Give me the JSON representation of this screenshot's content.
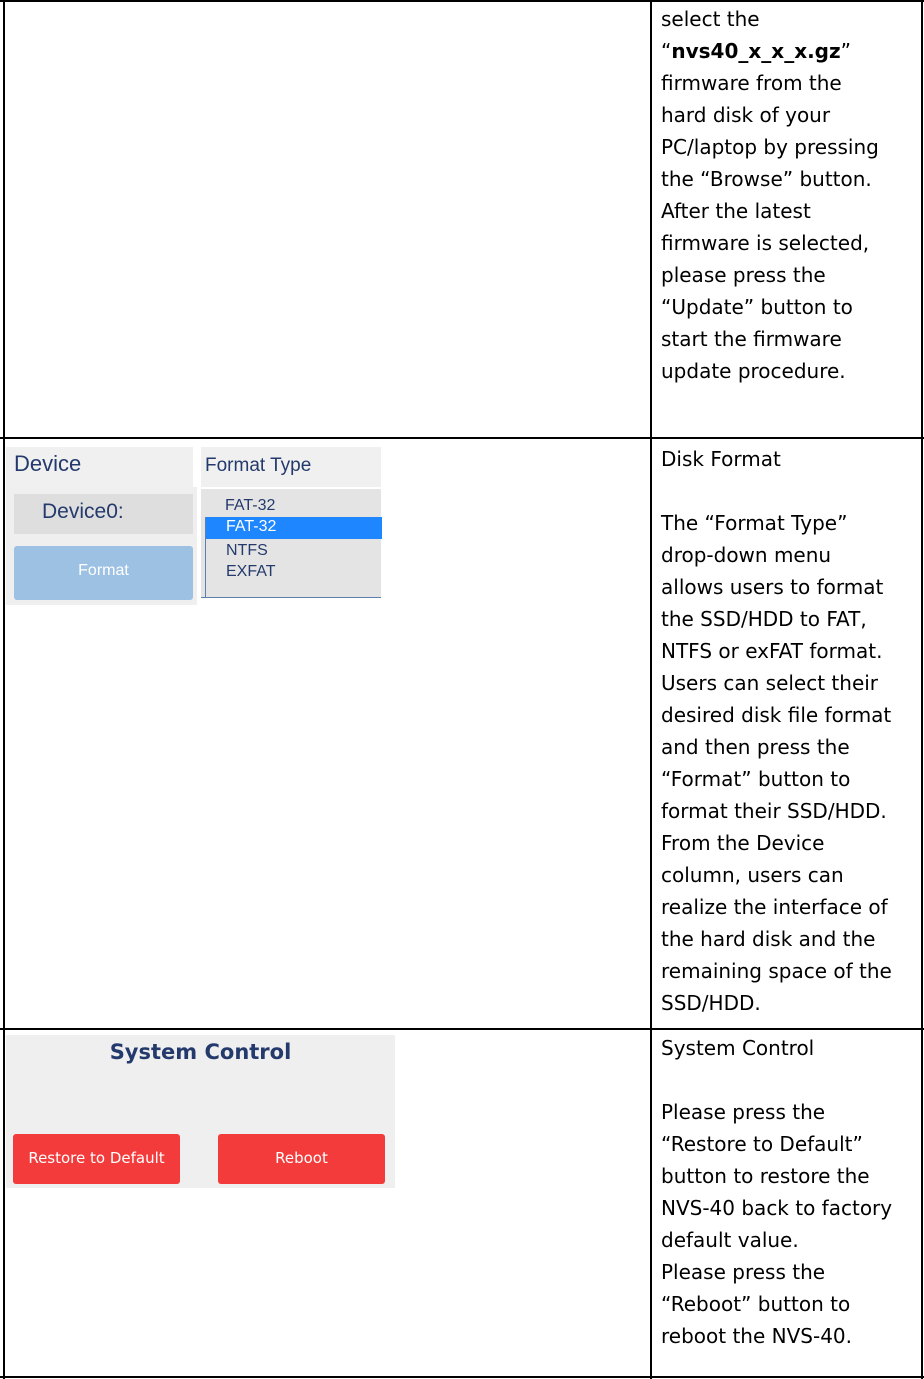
{
  "row1": {
    "lines": [
      "select the",
      "nvs40_x_x_x.gz",
      "firmware from the",
      "hard disk of your",
      "PC/laptop by pressing",
      "the “Browse” button.",
      "After the latest",
      "firmware is selected,",
      "please press the",
      "“Update” button to",
      "start the firmware",
      "update procedure."
    ]
  },
  "disk_format": {
    "device_header": "Device",
    "device_value": "Device0:",
    "format_button": "Format",
    "format_type_header": "Format Type",
    "current_selection": "FAT-32",
    "options": [
      "FAT-32",
      "NTFS",
      "EXFAT"
    ],
    "selected_option": "FAT-32",
    "description": {
      "title": "Disk Format",
      "lines": [
        "The “Format Type”",
        "drop-down menu",
        "allows users to format",
        "the SSD/HDD to FAT,",
        "NTFS or exFAT format.",
        "Users can select their",
        "desired disk file format",
        "and then press the",
        "“Format” button to",
        "format their SSD/HDD.",
        "From the Device",
        "column, users can",
        "realize the interface of",
        "the hard disk and the",
        "remaining space of the",
        "SSD/HDD."
      ]
    }
  },
  "system_control": {
    "title": "System Control",
    "restore_button": "Restore to Default",
    "reboot_button": "Reboot",
    "description": {
      "title": "System Control",
      "lines1": [
        "Please press the",
        "“Restore to Default”",
        "button to restore the",
        "NVS-40 back to factory",
        "default value."
      ],
      "lines2": [
        "Please press the",
        "“Reboot” button to",
        "reboot the NVS-40."
      ]
    }
  }
}
